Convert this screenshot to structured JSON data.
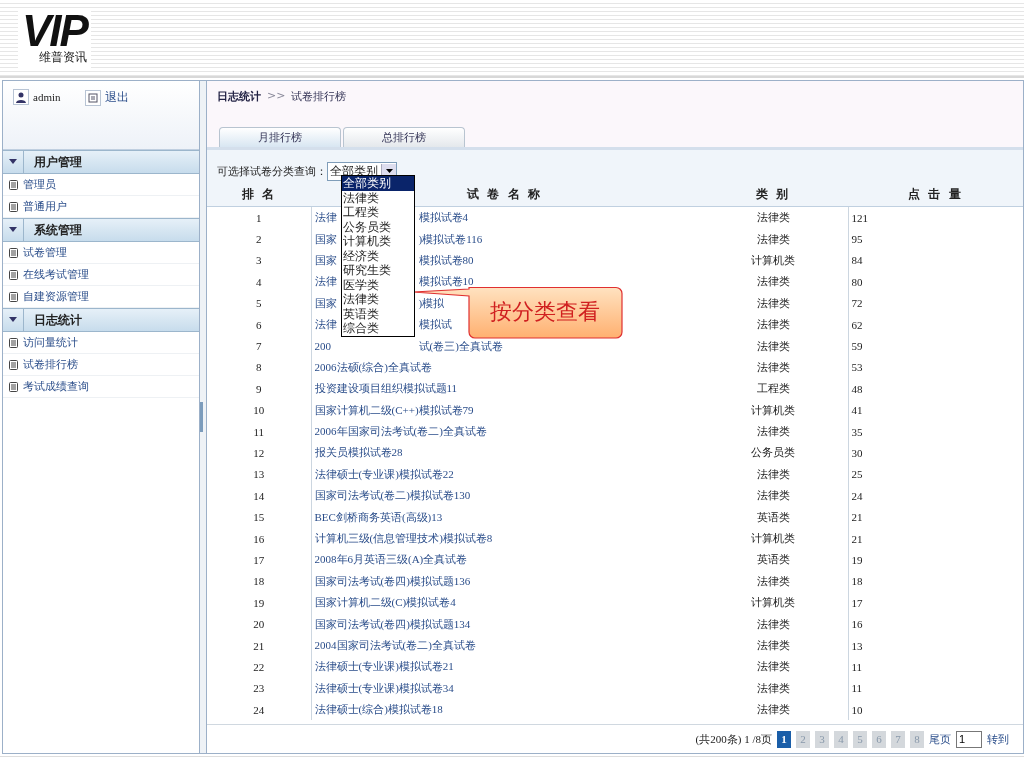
{
  "logo": {
    "mark": "VIP",
    "caption": "维普资讯"
  },
  "sidebar": {
    "user": "admin",
    "logout": "退出",
    "sections": [
      {
        "title": "用户管理",
        "expanded": true,
        "items": [
          {
            "label": "管理员"
          },
          {
            "label": "普通用户"
          }
        ]
      },
      {
        "title": "系统管理",
        "expanded": true,
        "items": [
          {
            "label": "试卷管理"
          },
          {
            "label": "在线考试管理"
          },
          {
            "label": "自建资源管理"
          }
        ]
      },
      {
        "title": "日志统计",
        "expanded": true,
        "items": [
          {
            "label": "访问量统计"
          },
          {
            "label": "试卷排行榜"
          },
          {
            "label": "考试成绩查询"
          }
        ]
      }
    ]
  },
  "breadcrumb": {
    "section": "日志统计",
    "separator": ">>",
    "page": "试卷排行榜"
  },
  "tabs": [
    {
      "label": "月排行榜",
      "selected": true
    },
    {
      "label": "总排行榜",
      "selected": false
    }
  ],
  "filter": {
    "label": "可选择试卷分类查询：",
    "value": "全部类别",
    "options": [
      {
        "label": "全部类别",
        "selected": true
      },
      {
        "label": "法律类",
        "selected": false
      },
      {
        "label": "工程类",
        "selected": false
      },
      {
        "label": "公务员类",
        "selected": false
      },
      {
        "label": "计算机类",
        "selected": false
      },
      {
        "label": "经济类",
        "selected": false
      },
      {
        "label": "研究生类",
        "selected": false
      },
      {
        "label": "医学类",
        "selected": false
      },
      {
        "label": "法律类",
        "selected": false
      },
      {
        "label": "英语类",
        "selected": false
      },
      {
        "label": "综合类",
        "selected": false
      }
    ]
  },
  "callout": "按分类查看",
  "table": {
    "columns": [
      "排 名",
      "试 卷 名 称",
      "类 别",
      "点 击 量"
    ],
    "rows": [
      {
        "rank": "1",
        "name_start": "法律",
        "name_end": "模拟试卷4",
        "category": "法律类",
        "clicks": "121"
      },
      {
        "rank": "2",
        "name_start": "国家",
        "name_end": ")模拟试卷116",
        "category": "法律类",
        "clicks": "95"
      },
      {
        "rank": "3",
        "name_start": "国家",
        "name_end": "模拟试卷80",
        "category": "计算机类",
        "clicks": "84"
      },
      {
        "rank": "4",
        "name_start": "法律",
        "name_end": "模拟试卷10",
        "category": "法律类",
        "clicks": "80"
      },
      {
        "rank": "5",
        "name_start": "国家",
        "name_end": ")模拟",
        "category": "法律类",
        "clicks": "72"
      },
      {
        "rank": "6",
        "name_start": "法律",
        "name_end": "模拟试",
        "category": "法律类",
        "clicks": "62"
      },
      {
        "rank": "7",
        "name_start": "200",
        "name_end": "试(卷三)全真试卷",
        "category": "法律类",
        "clicks": "59"
      },
      {
        "rank": "8",
        "name": "2006法硕(综合)全真试卷",
        "category": "法律类",
        "clicks": "53"
      },
      {
        "rank": "9",
        "name": "投资建设项目组织模拟试题11",
        "category": "工程类",
        "clicks": "48"
      },
      {
        "rank": "10",
        "name": "国家计算机二级(C++)模拟试卷79",
        "category": "计算机类",
        "clicks": "41"
      },
      {
        "rank": "11",
        "name": "2006年国家司法考试(卷二)全真试卷",
        "category": "法律类",
        "clicks": "35"
      },
      {
        "rank": "12",
        "name": "报关员模拟试卷28",
        "category": "公务员类",
        "clicks": "30"
      },
      {
        "rank": "13",
        "name": "法律硕士(专业课)模拟试卷22",
        "category": "法律类",
        "clicks": "25"
      },
      {
        "rank": "14",
        "name": "国家司法考试(卷二)模拟试卷130",
        "category": "法律类",
        "clicks": "24"
      },
      {
        "rank": "15",
        "name": "BEC剑桥商务英语(高级)13",
        "category": "英语类",
        "clicks": "21"
      },
      {
        "rank": "16",
        "name": "计算机三级(信息管理技术)模拟试卷8",
        "category": "计算机类",
        "clicks": "21"
      },
      {
        "rank": "17",
        "name": "2008年6月英语三级(A)全真试卷",
        "category": "英语类",
        "clicks": "19"
      },
      {
        "rank": "18",
        "name": "国家司法考试(卷四)模拟试题136",
        "category": "法律类",
        "clicks": "18"
      },
      {
        "rank": "19",
        "name": "国家计算机二级(C)模拟试卷4",
        "category": "计算机类",
        "clicks": "17"
      },
      {
        "rank": "20",
        "name": "国家司法考试(卷四)模拟试题134",
        "category": "法律类",
        "clicks": "16"
      },
      {
        "rank": "21",
        "name": "2004国家司法考试(卷二)全真试卷",
        "category": "法律类",
        "clicks": "13"
      },
      {
        "rank": "22",
        "name": "法律硕士(专业课)模拟试卷21",
        "category": "法律类",
        "clicks": "11"
      },
      {
        "rank": "23",
        "name": "法律硕士(专业课)模拟试卷34",
        "category": "法律类",
        "clicks": "11"
      },
      {
        "rank": "24",
        "name": "法律硕士(综合)模拟试卷18",
        "category": "法律类",
        "clicks": "10"
      }
    ]
  },
  "pagination": {
    "summary": "(共200条) 1 /8页",
    "pages": [
      {
        "label": "1",
        "selected": true
      },
      {
        "label": "2",
        "selected": false
      },
      {
        "label": "3",
        "selected": false
      },
      {
        "label": "4",
        "selected": false
      },
      {
        "label": "5",
        "selected": false
      },
      {
        "label": "6",
        "selected": false
      },
      {
        "label": "7",
        "selected": false
      },
      {
        "label": "8",
        "selected": false
      }
    ],
    "last": "尾页",
    "page_input": "1",
    "go": "转到"
  }
}
